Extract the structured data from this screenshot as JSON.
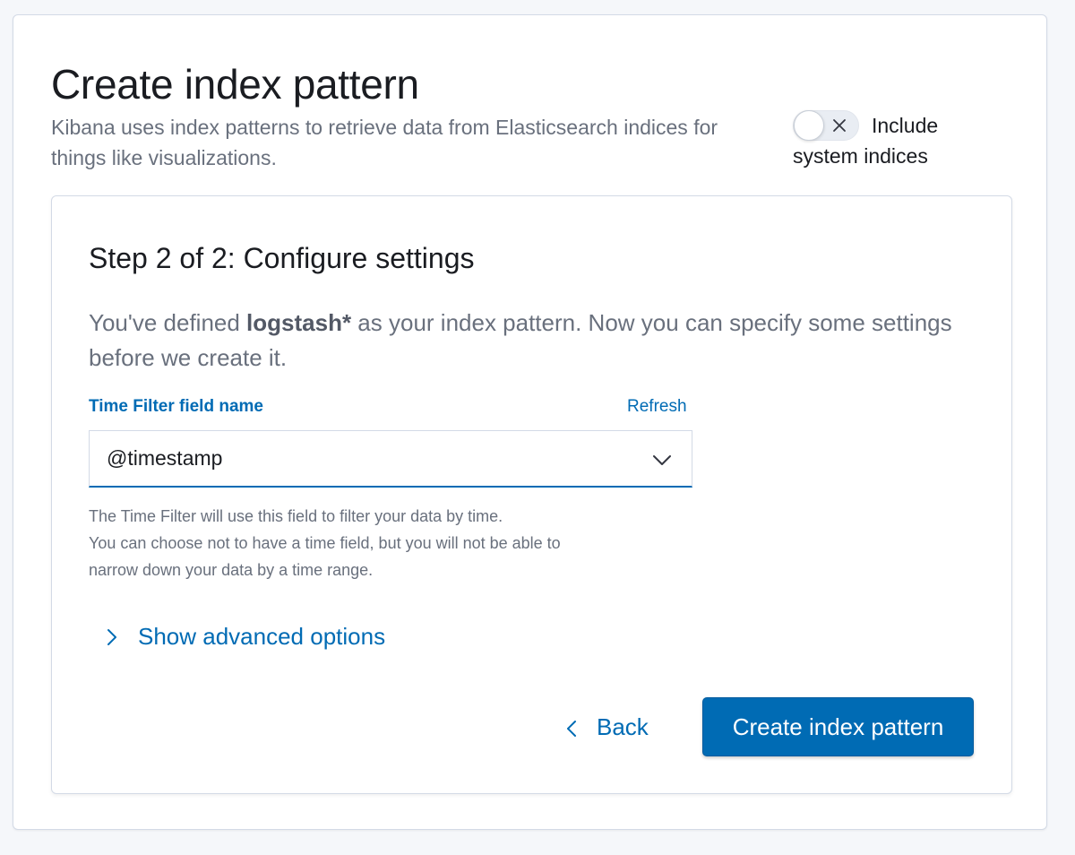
{
  "header": {
    "title": "Create index pattern",
    "description": "Kibana uses index patterns to retrieve data from Elasticsearch indices for things like visualizations."
  },
  "system_indices_toggle": {
    "label_line1": "Include",
    "label_line2": "system indices",
    "checked": false,
    "icon": "close-icon"
  },
  "step": {
    "title": "Step 2 of 2: Configure settings",
    "description_before": "You've defined ",
    "pattern": "logstash*",
    "description_after": " as your index pattern. Now you can specify some settings before we create it."
  },
  "time_filter": {
    "label": "Time Filter field name",
    "refresh_label": "Refresh",
    "selected_value": "@timestamp",
    "help_line1": "The Time Filter will use this field to filter your data by time.",
    "help_line2": "You can choose not to have a time field, but you will not be able to",
    "help_line3": "narrow down your data by a time range."
  },
  "advanced": {
    "label": "Show advanced options"
  },
  "actions": {
    "back_label": "Back",
    "create_label": "Create index pattern"
  },
  "colors": {
    "accent": "#006bb4",
    "text_subdued": "#69707d",
    "border": "#d3dae6"
  }
}
